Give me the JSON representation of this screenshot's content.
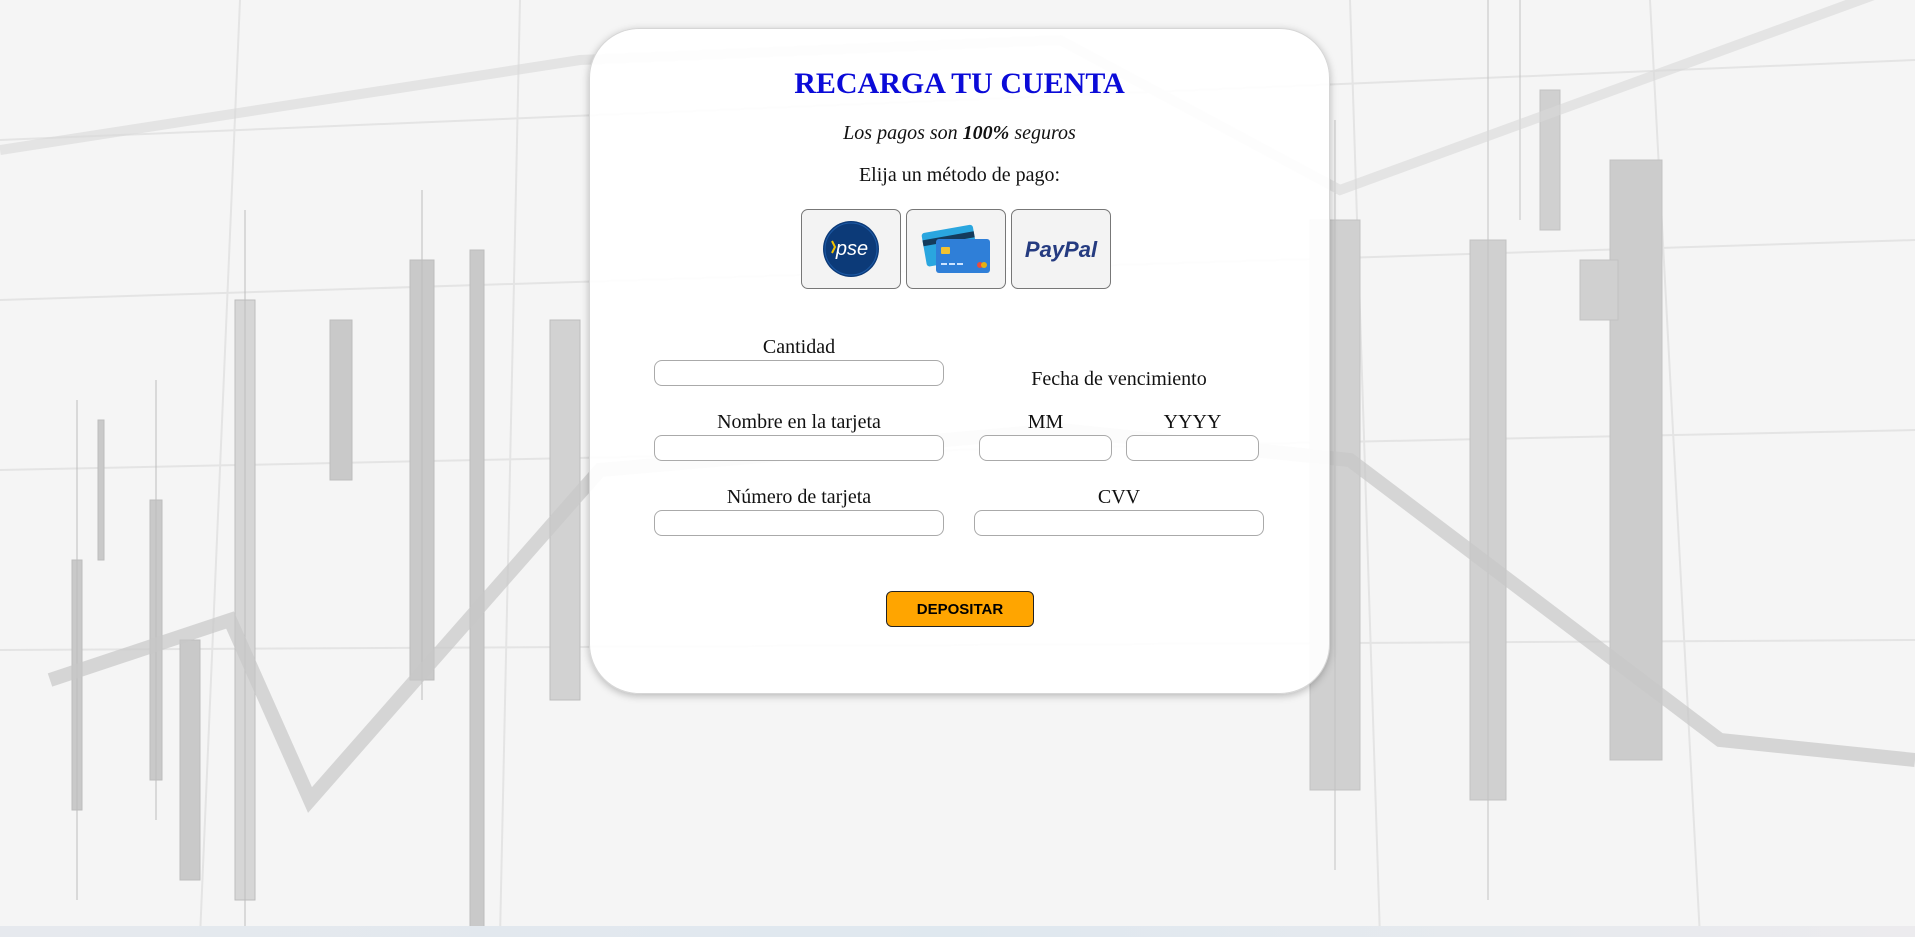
{
  "page": {
    "title": "RECARGA TU CUENTA",
    "subtitle_prefix": "Los pagos son ",
    "subtitle_bold": "100%",
    "subtitle_suffix": " seguros",
    "choose_method": "Elija un método de pago:"
  },
  "payment_methods": [
    {
      "name": "pse",
      "icon": "pse-logo-icon",
      "text": "pse"
    },
    {
      "name": "card",
      "icon": "credit-cards-icon"
    },
    {
      "name": "paypal",
      "icon": "paypal-logo-icon",
      "text": "PayPal"
    }
  ],
  "form": {
    "amount_label": "Cantidad",
    "amount_value": "",
    "name_label": "Nombre en la tarjeta",
    "name_value": "",
    "card_number_label": "Número de tarjeta",
    "card_number_value": "",
    "expiry_label": "Fecha de vencimiento",
    "month_label": "MM",
    "month_value": "",
    "year_label": "YYYY",
    "year_value": "",
    "cvv_label": "CVV",
    "cvv_value": "",
    "submit_label": "DEPOSITAR"
  },
  "colors": {
    "title": "#0b0bd8",
    "submit_button": "#ffa500",
    "pse_blue": "#0c3a78",
    "paypal_dark": "#253b80",
    "paypal_light": "#179bd7"
  }
}
